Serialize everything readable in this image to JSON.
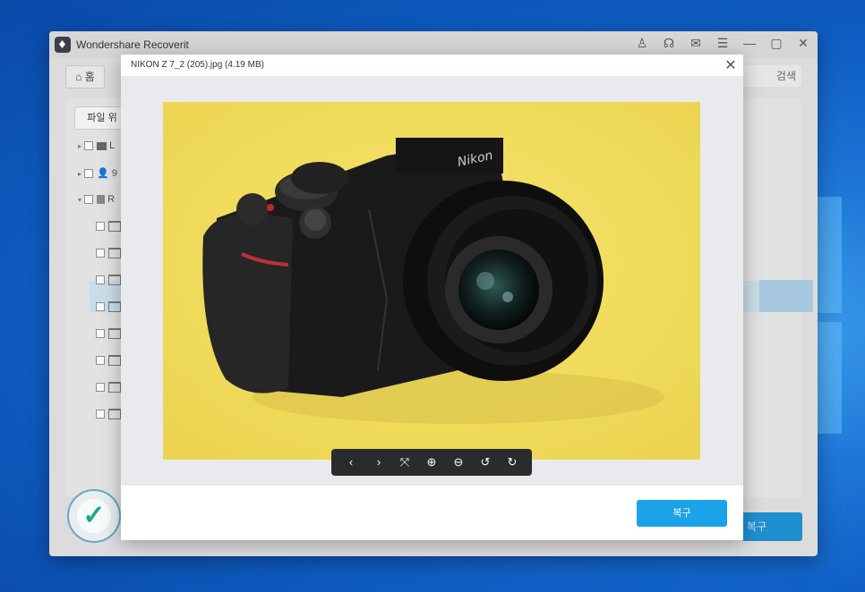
{
  "app": {
    "title": "Wondershare Recoverit",
    "home_label": "홈",
    "search_placeholder": "검색",
    "tab_file": "파일 위",
    "recover_label": "복구"
  },
  "modal": {
    "title": "NIKON Z 7_2 (205).jpg (4.19 MB)",
    "recover_label": "복구",
    "image_alt": "Nikon Z camera on yellow background",
    "controls": [
      {
        "icon": "chevron-left-icon",
        "glyph": "‹"
      },
      {
        "icon": "chevron-right-icon",
        "glyph": "›"
      },
      {
        "icon": "fullscreen-icon",
        "glyph": "⤧"
      },
      {
        "icon": "zoom-in-icon",
        "glyph": "⊕"
      },
      {
        "icon": "zoom-out-icon",
        "glyph": "⊖"
      },
      {
        "icon": "rotate-left-icon",
        "glyph": "↺"
      },
      {
        "icon": "rotate-right-icon",
        "glyph": "↻"
      }
    ]
  },
  "tree": {
    "drive_items": [
      "L",
      "9",
      "R"
    ],
    "folder_count": 8
  },
  "colors": {
    "accent": "#1aa3e8",
    "photo_bg": "#f2df5e"
  }
}
